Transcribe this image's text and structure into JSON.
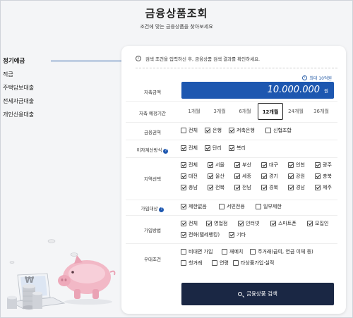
{
  "page": {
    "title": "금융상품조회",
    "subtitle": "조건에 맞는 금융상품을 찾아보세요"
  },
  "sidebar": {
    "items": [
      {
        "label": "정기예금",
        "active": true
      },
      {
        "label": "적금",
        "active": false
      },
      {
        "label": "주택담보대출",
        "active": false
      },
      {
        "label": "전세자금대출",
        "active": false
      },
      {
        "label": "개인신용대출",
        "active": false
      }
    ]
  },
  "form": {
    "info_text": "검색 조건을 입력하신 후, 금융상품 검색 결과를 확인하세요.",
    "max_note": "최대 10억원",
    "amount": {
      "label": "저축금액",
      "value": "10.000.000",
      "unit": "원"
    },
    "period": {
      "label": "저축 예정기간",
      "options": [
        "1개월",
        "3개월",
        "6개월",
        "12개월",
        "24개월",
        "36개월"
      ],
      "selected": "12개월"
    },
    "institution": {
      "label": "금융권역",
      "options": [
        {
          "label": "전체",
          "checked": false
        },
        {
          "label": "은행",
          "checked": true
        },
        {
          "label": "저축은행",
          "checked": true
        },
        {
          "label": "신협조합",
          "checked": false
        }
      ]
    },
    "interest": {
      "label": "이자계산방식",
      "options": [
        {
          "label": "전체",
          "checked": true
        },
        {
          "label": "단리",
          "checked": true
        },
        {
          "label": "복리",
          "checked": true
        }
      ]
    },
    "region": {
      "label": "지역선택",
      "options": [
        {
          "label": "전체",
          "checked": true
        },
        {
          "label": "서울",
          "checked": true
        },
        {
          "label": "부산",
          "checked": true
        },
        {
          "label": "대구",
          "checked": true
        },
        {
          "label": "인천",
          "checked": true
        },
        {
          "label": "광주",
          "checked": true
        },
        {
          "label": "대전",
          "checked": true
        },
        {
          "label": "울산",
          "checked": true
        },
        {
          "label": "세종",
          "checked": true
        },
        {
          "label": "경기",
          "checked": true
        },
        {
          "label": "강원",
          "checked": true
        },
        {
          "label": "충북",
          "checked": true
        },
        {
          "label": "충남",
          "checked": true
        },
        {
          "label": "전북",
          "checked": true
        },
        {
          "label": "전남",
          "checked": true
        },
        {
          "label": "경북",
          "checked": true
        },
        {
          "label": "경남",
          "checked": true
        },
        {
          "label": "제주",
          "checked": true
        }
      ]
    },
    "target": {
      "label": "가입대상",
      "options": [
        {
          "label": "제한없음",
          "checked": true
        },
        {
          "label": "서민전용",
          "checked": false
        },
        {
          "label": "일부제한",
          "checked": false
        }
      ]
    },
    "method": {
      "label": "가입방법",
      "options": [
        {
          "label": "전체",
          "checked": true
        },
        {
          "label": "영업점",
          "checked": true
        },
        {
          "label": "인터넷",
          "checked": true
        },
        {
          "label": "스마트폰",
          "checked": true
        },
        {
          "label": "모집인",
          "checked": true
        },
        {
          "label": "전화(텔레뱅킹)",
          "checked": true
        },
        {
          "label": "기타",
          "checked": true
        }
      ]
    },
    "preferential": {
      "label": "우대조건",
      "options": [
        {
          "label": "비대면 가입",
          "checked": false
        },
        {
          "label": "재예치",
          "checked": false
        },
        {
          "label": "주거래(급여, 연금 이체 등)",
          "checked": false
        },
        {
          "label": "첫거래",
          "checked": false
        },
        {
          "label": "연령",
          "checked": false
        },
        {
          "label": "타상품가입·실적",
          "checked": false
        }
      ]
    },
    "search_button": "금융상품 검색"
  },
  "colors": {
    "accent": "#1d57b0",
    "button_dark": "#1a2744",
    "piggy": "#f2b8c6"
  }
}
